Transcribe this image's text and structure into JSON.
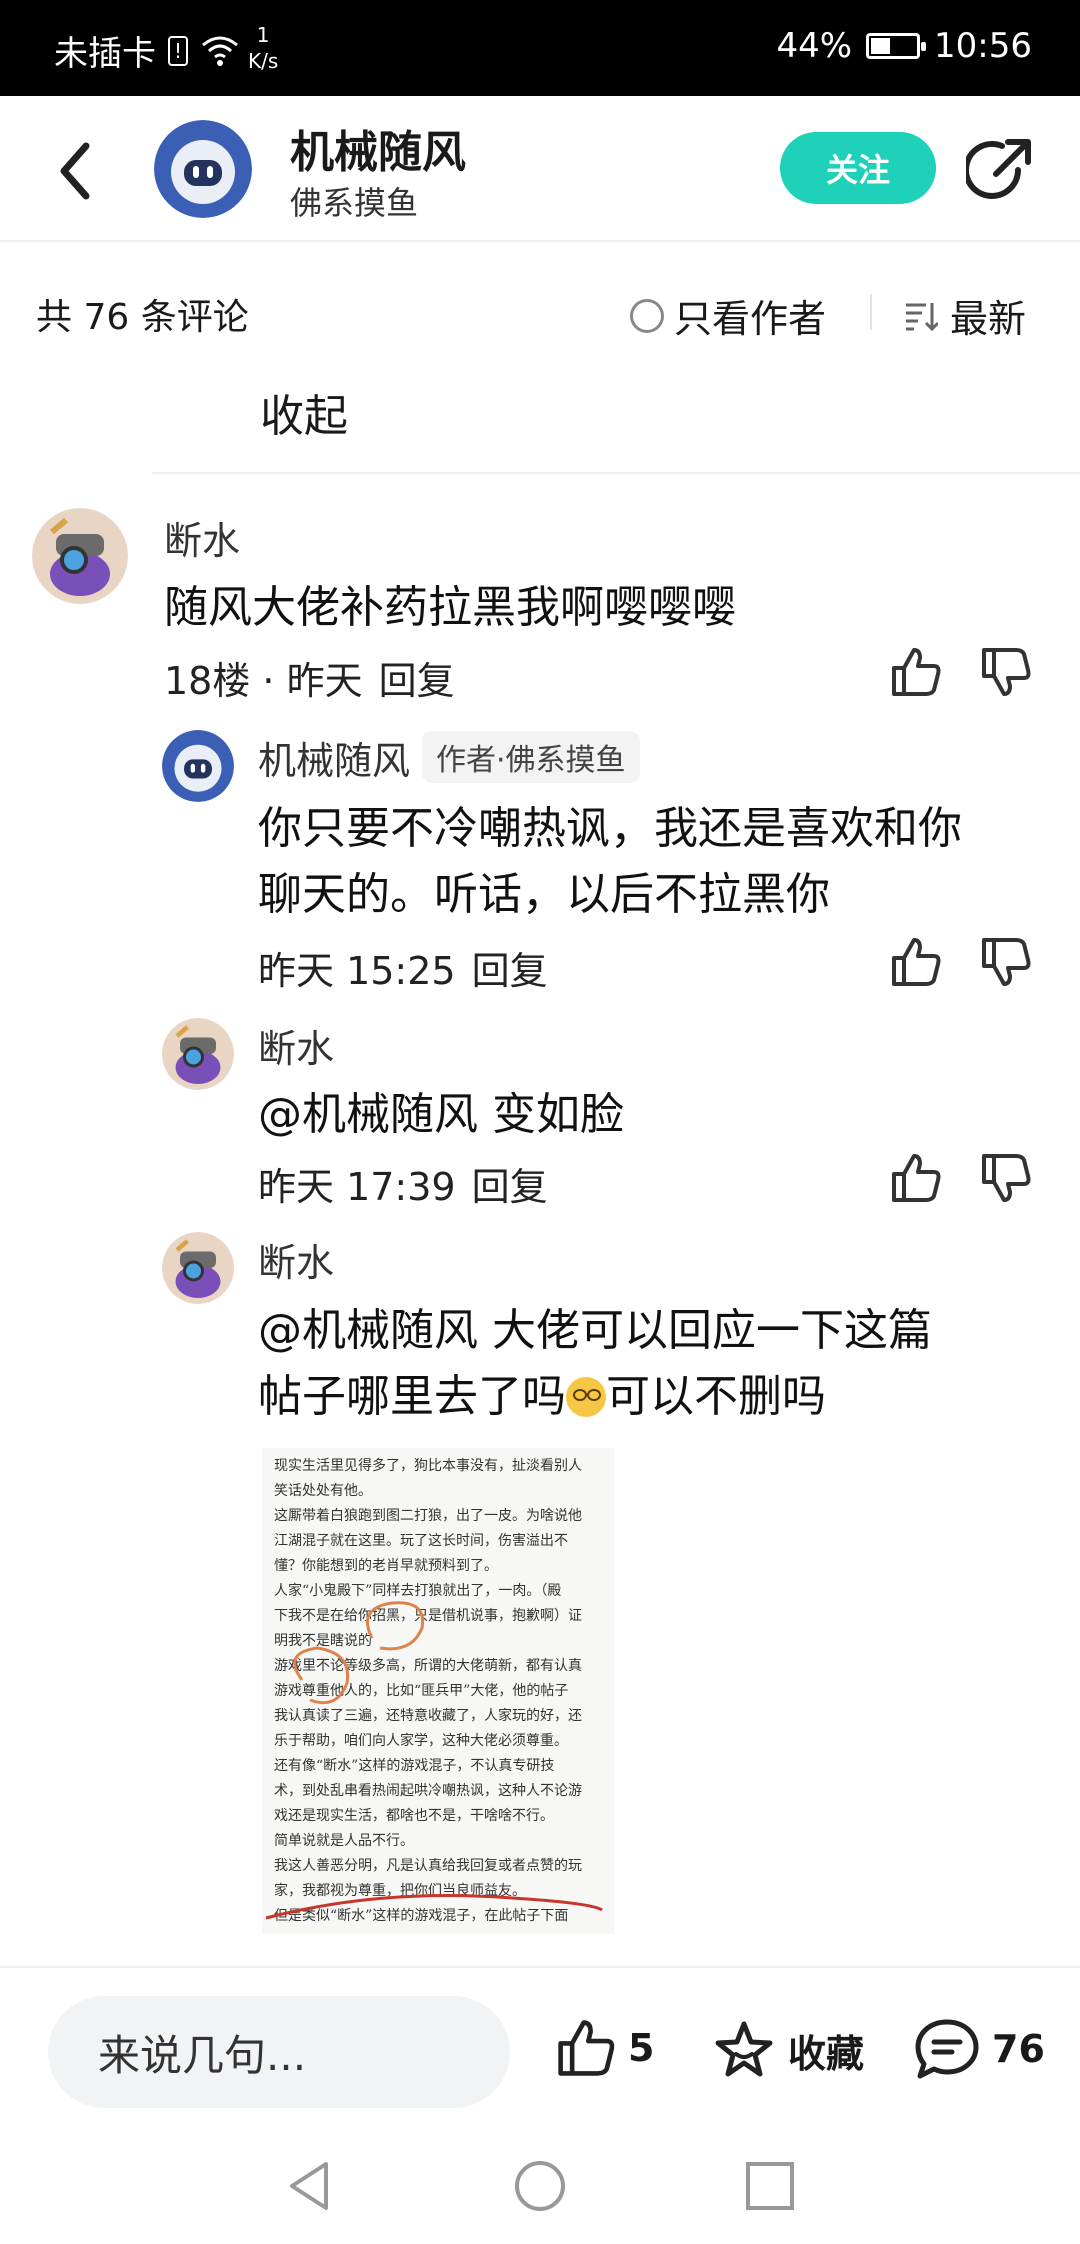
{
  "status": {
    "carrier": "未插卡",
    "speed_value": "1",
    "speed_unit": "K/s",
    "signal": "44%",
    "time": "10:56",
    "battery_level": 0.44
  },
  "header": {
    "title": "机械随风",
    "subtitle": "佛系摸鱼",
    "follow_label": "关注"
  },
  "filter": {
    "count_text": "共 76 条评论",
    "author_only_label": "只看作者",
    "sort_label": "最新"
  },
  "collapse_label": "收起",
  "comment": {
    "user": "断水",
    "text": "随风大佬补药拉黑我啊嘤嘤嘤",
    "floor_time": "18楼 · 昨天",
    "reply_label": "回复"
  },
  "replies": [
    {
      "user": "机械随风",
      "badge": "作者·佛系摸鱼",
      "line1": "你只要不冷嘲热讽，我还是喜欢和你",
      "line2": "聊天的。听话，以后不拉黑你",
      "time": "昨天 15:25",
      "reply_label": "回复"
    },
    {
      "user": "断水",
      "line1": "@机械随风  变如脸",
      "time": "昨天 17:39",
      "reply_label": "回复"
    },
    {
      "user": "断水",
      "line1": "@机械随风  大佬可以回应一下这篇",
      "line2a": "帖子哪里去了吗",
      "line2b": "可以不删吗"
    }
  ],
  "scan_lines": [
    "现实生活里见得多了，狗比本事没有，扯淡看别人",
    "笑话处处有他。",
    "这厮带着白狼跑到图二打狼，出了一皮。为啥说他",
    "江湖混子就在这里。玩了这长时间，伤害溢出不",
    "懂？你能想到的老肖早就预料到了。",
    "人家“小鬼殿下”同样去打狼就出了，一肉。（殿",
    "下我不是在给你招黑，只是借机说事，抱歉啊）证",
    "明我不是瞎说的",
    "游戏里不论等级多高，所谓的大佬萌新，都有认真",
    "游戏尊重他人的，比如“匪兵甲”大佬，他的帖子",
    "我认真读了三遍，还特意收藏了，人家玩的好，还",
    "乐于帮助，咱们向人家学，这种大佬必须尊重。",
    "还有像“断水”这样的游戏混子，不认真专研技",
    "术，到处乱串看热闹起哄冷嘲热讽，这种人不论游",
    "戏还是现实生活，都啥也不是，干啥啥不行。",
    "简单说就是人品不行。",
    "我这人善恶分明，凡是认真给我回复或者点赞的玩",
    "家，我都视为尊重，把你们当良师益友。",
    "但是类似“断水”这样的游戏混子，在此帖子下面"
  ],
  "bottom": {
    "input_placeholder": "来说几句...",
    "likes": "5",
    "favorite_label": "收藏",
    "comments": "76"
  },
  "colors": {
    "accent": "#1ed1b8",
    "ink_mark": "#e0824a",
    "underline": "#c8362b"
  }
}
